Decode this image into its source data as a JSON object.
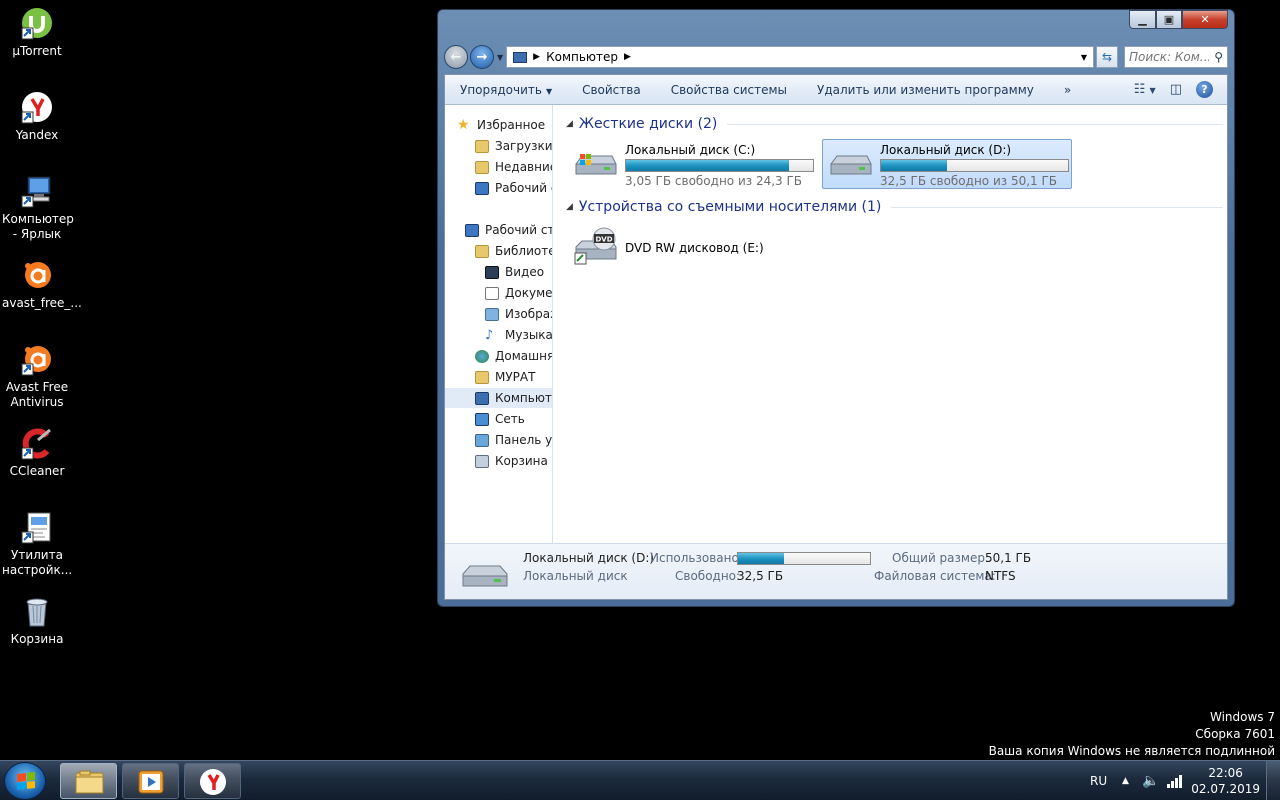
{
  "desktop": {
    "icons": [
      {
        "label": "µTorrent",
        "icon": "utorrent-icon"
      },
      {
        "label": "Yandex",
        "icon": "yandex-icon"
      },
      {
        "label": "Компьютер - Ярлык",
        "icon": "computer-shortcut-icon"
      },
      {
        "label": "avast_free_...",
        "icon": "avast-installer-icon"
      },
      {
        "label": "Avast Free Antivirus",
        "icon": "avast-icon"
      },
      {
        "label": "CCleaner",
        "icon": "ccleaner-icon"
      },
      {
        "label": "Утилита настройк...",
        "icon": "utility-icon"
      },
      {
        "label": "Корзина",
        "icon": "recycle-bin-icon"
      }
    ],
    "watermark": {
      "line1": "Windows 7",
      "line2": "Сборка 7601",
      "line3": "Ваша копия Windows не является подлинной"
    }
  },
  "explorer": {
    "address": {
      "path_root_icon": "computer-icon",
      "path": "Компьютер",
      "search_placeholder": "Поиск: Ком..."
    },
    "toolbar": {
      "organize": "Упорядочить",
      "properties": "Свойства",
      "system_properties": "Свойства системы",
      "uninstall": "Удалить или изменить программу",
      "more": "»"
    },
    "nav_pane": [
      {
        "label": "Избранное",
        "icon": "star-icon",
        "level": 0
      },
      {
        "label": "Загрузки",
        "icon": "downloads-folder-icon",
        "level": 1
      },
      {
        "label": "Недавние",
        "icon": "recent-places-icon",
        "level": 1
      },
      {
        "label": "Рабочий с",
        "icon": "desktop-icon",
        "level": 1
      },
      {
        "label": "Рабочий сто",
        "icon": "desktop-icon",
        "level": 0
      },
      {
        "label": "Библиоте",
        "icon": "libraries-icon",
        "level": 1
      },
      {
        "label": "Видео",
        "icon": "video-icon",
        "level": 2
      },
      {
        "label": "Докумен",
        "icon": "documents-icon",
        "level": 2
      },
      {
        "label": "Изображ",
        "icon": "pictures-icon",
        "level": 2
      },
      {
        "label": "Музыка",
        "icon": "music-icon",
        "level": 2
      },
      {
        "label": "Домашня",
        "icon": "homegroup-icon",
        "level": 1
      },
      {
        "label": "МУРАТ",
        "icon": "user-folder-icon",
        "level": 1
      },
      {
        "label": "Компьюте",
        "icon": "computer-icon",
        "level": 1,
        "selected": true
      },
      {
        "label": "Сеть",
        "icon": "network-icon",
        "level": 1
      },
      {
        "label": "Панель уп",
        "icon": "control-panel-icon",
        "level": 1
      },
      {
        "label": "Корзина",
        "icon": "recycle-bin-icon",
        "level": 1
      }
    ],
    "groups": {
      "hard_disks": "Жесткие диски (2)",
      "removable": "Устройства со съемными носителями (1)"
    },
    "drives": [
      {
        "name": "Локальный диск (C:)",
        "free_text": "3,05 ГБ свободно из 24,3 ГБ",
        "used_fraction": 0.874,
        "selected": false
      },
      {
        "name": "Локальный диск (D:)",
        "free_text": "32,5 ГБ свободно из 50,1 ГБ",
        "used_fraction": 0.351,
        "selected": true
      }
    ],
    "dvd": {
      "name": "DVD RW дисковод (E:)",
      "badge": "DVD"
    },
    "details": {
      "name": "Локальный диск (D:)",
      "type": "Локальный диск",
      "used_label": "Использовано:",
      "used_fraction": 0.351,
      "free_label": "Свободно:",
      "free_value": "32,5 ГБ",
      "total_label": "Общий размер:",
      "total_value": "50,1 ГБ",
      "fs_label": "Файловая система:",
      "fs_value": "NTFS"
    }
  },
  "taskbar": {
    "buttons": [
      "explorer-icon",
      "media-player-icon",
      "yandex-icon"
    ],
    "language": "RU",
    "time": "22:06",
    "date": "02.07.2019"
  }
}
